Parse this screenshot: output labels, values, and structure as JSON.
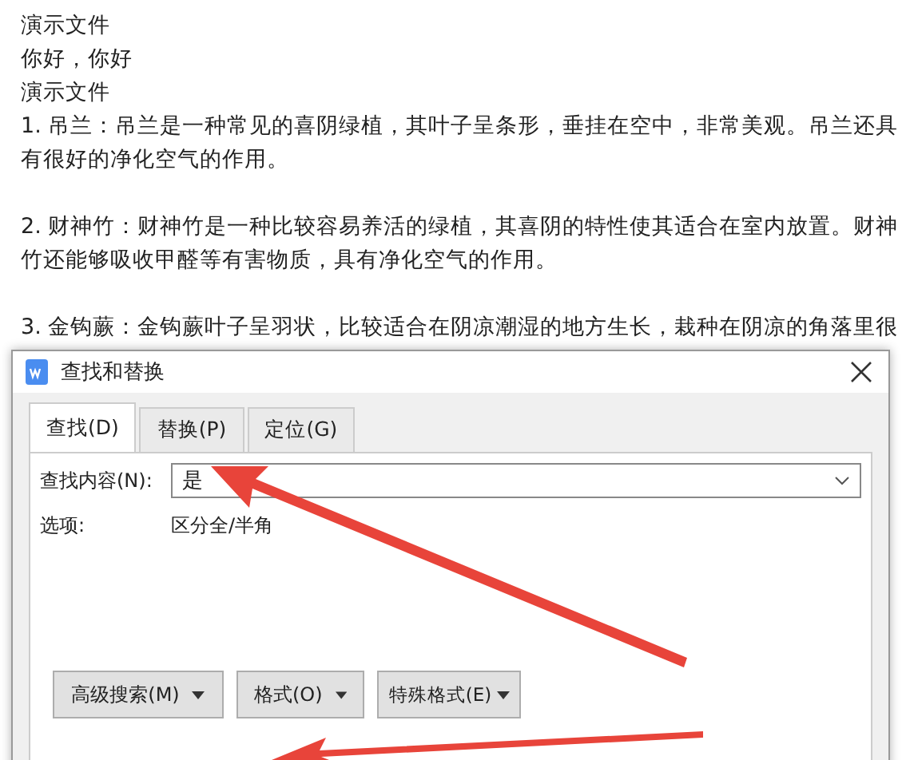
{
  "document": {
    "lines": [
      "演示文件",
      "你好，你好",
      "演示文件"
    ],
    "paragraphs": [
      [
        "1. 吊兰：吊兰是一种常见的喜阴绿植，其叶子呈条形，垂挂在空中，非常美观。吊兰还具",
        "有很好的净化空气的作用。"
      ],
      [
        "2. 财神竹：财神竹是一种比较容易养活的绿植，其喜阴的特性使其适合在室内放置。财神",
        "竹还能够吸收甲醛等有害物质，具有净化空气的作用。"
      ],
      [
        "3. 金钩蕨：金钩蕨叶子呈羽状，比较适合在阴凉潮湿的地方生长，栽种在阴凉的角落里很"
      ]
    ]
  },
  "dialog": {
    "title": "查找和替换",
    "tabs": [
      {
        "label": "查找(D)",
        "selected": true
      },
      {
        "label": "替换(P)",
        "selected": false
      },
      {
        "label": "定位(G)",
        "selected": false
      }
    ],
    "find_label": "查找内容(N):",
    "find_value": "是",
    "options_label": "选项:",
    "options_value": "区分全/半角",
    "buttons": [
      "高级搜索(M)",
      "格式(O)",
      "特殊格式(E)"
    ]
  }
}
